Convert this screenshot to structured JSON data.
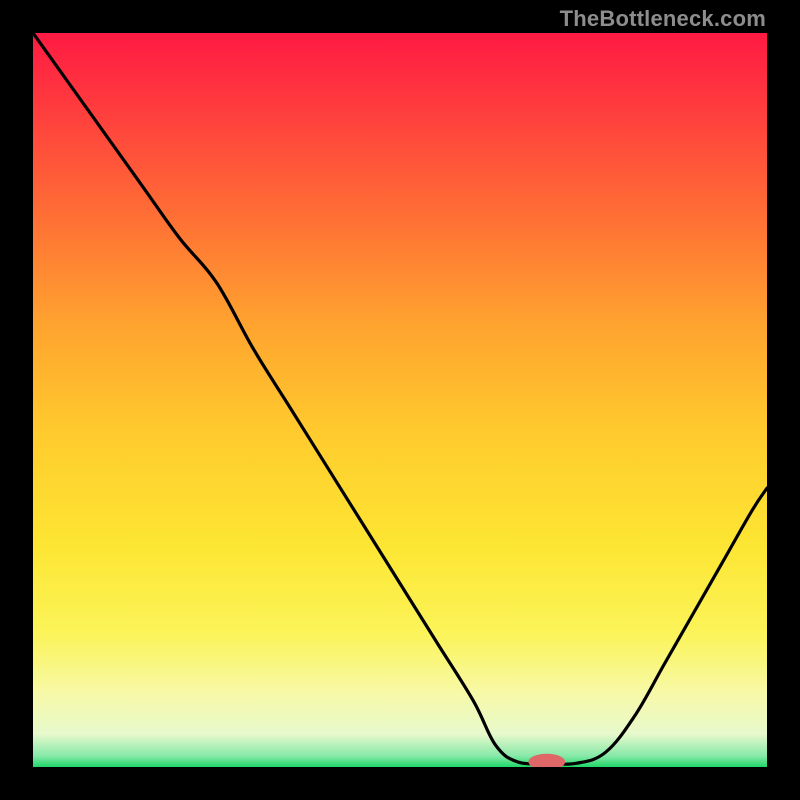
{
  "watermark": "TheBottleneck.com",
  "chart_data": {
    "type": "line",
    "title": "",
    "xlabel": "",
    "ylabel": "",
    "xlim": [
      0,
      100
    ],
    "ylim": [
      0,
      100
    ],
    "background_gradient": {
      "stops": [
        {
          "pos": 0.0,
          "color": "#ff1a43"
        },
        {
          "pos": 0.1,
          "color": "#ff3b3e"
        },
        {
          "pos": 0.25,
          "color": "#ff6f35"
        },
        {
          "pos": 0.4,
          "color": "#ffa42f"
        },
        {
          "pos": 0.55,
          "color": "#ffcc2d"
        },
        {
          "pos": 0.7,
          "color": "#fde633"
        },
        {
          "pos": 0.82,
          "color": "#fbf45a"
        },
        {
          "pos": 0.9,
          "color": "#f7f9a8"
        },
        {
          "pos": 0.955,
          "color": "#e7f9cc"
        },
        {
          "pos": 0.985,
          "color": "#87e9a8"
        },
        {
          "pos": 1.0,
          "color": "#1fd76a"
        }
      ]
    },
    "series": [
      {
        "name": "bottleneck-curve",
        "x": [
          0,
          5,
          10,
          15,
          20,
          25,
          30,
          35,
          40,
          45,
          50,
          55,
          60,
          63,
          66,
          70,
          74,
          78,
          82,
          86,
          90,
          94,
          98,
          100
        ],
        "y": [
          100,
          93,
          86,
          79,
          72,
          66,
          57,
          49,
          41,
          33,
          25,
          17,
          9,
          3,
          0.7,
          0.5,
          0.5,
          2,
          7,
          14,
          21,
          28,
          35,
          38
        ]
      }
    ],
    "marker": {
      "name": "optimal-point",
      "x": 70,
      "y": 0.7,
      "rx": 2.5,
      "ry": 1.1,
      "color": "#e06767"
    }
  }
}
